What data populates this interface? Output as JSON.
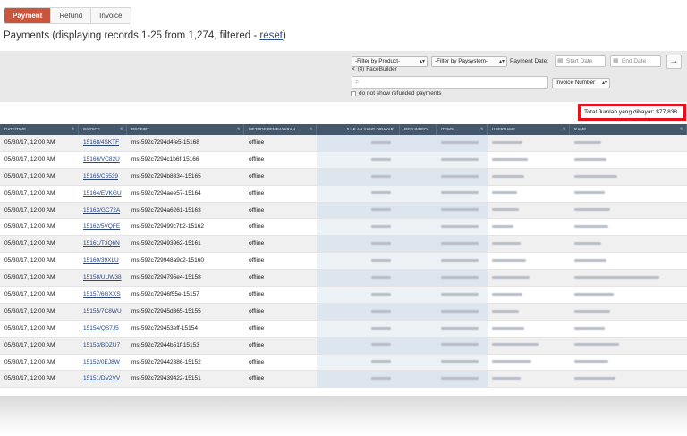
{
  "tabs": [
    {
      "label": "Payment",
      "active": true
    },
    {
      "label": "Refund",
      "active": false
    },
    {
      "label": "Invoice",
      "active": false
    }
  ],
  "title": {
    "prefix": "Payments (displaying records 1-25 from 1,274, filtered - ",
    "reset": "reset",
    "suffix": ")"
  },
  "filters": {
    "product": "-Filter by Product-",
    "paysystem": "-Filter by Paysystem-",
    "payment_date_label": "Payment Date:",
    "start_date_placeholder": "Start Date",
    "end_date_placeholder": "End Date",
    "chip_label": "(4) FaceBuilder",
    "search_placeholder": "",
    "search_field": "Invoice Number",
    "refund_checkbox_label": "do not show refunded payments"
  },
  "total_label": "Total Jumlah yang dibayar: $77,838",
  "columns": [
    "DATE/TIME",
    "INVOICE",
    "RECEIPT",
    "METODE PEMBAYARAN",
    "JUMLAH YANG DIBAYAR",
    "REFUNDED",
    "ITEMS",
    "USERNAME",
    "NAME"
  ],
  "rows": [
    {
      "date": "05/30/17, 12:00 AM",
      "invoice": "15168/4SKTF",
      "receipt": "ms-592c7294d4fe5-15168",
      "method": "offline"
    },
    {
      "date": "05/30/17, 12:00 AM",
      "invoice": "15166/VC82U",
      "receipt": "ms-592c7294c1b6f-15166",
      "method": "offline"
    },
    {
      "date": "05/30/17, 12:00 AM",
      "invoice": "15165/C5539",
      "receipt": "ms-592c7294b8334-15165",
      "method": "offline"
    },
    {
      "date": "05/30/17, 12:00 AM",
      "invoice": "15164/EVKGU",
      "receipt": "ms-592c7294aee57-15164",
      "method": "offline"
    },
    {
      "date": "05/30/17, 12:00 AM",
      "invoice": "15163/GC72A",
      "receipt": "ms-592c7294a6261-15163",
      "method": "offline"
    },
    {
      "date": "05/30/17, 12:00 AM",
      "invoice": "15162/5VQFE",
      "receipt": "ms-592c729499c7b2-15162",
      "method": "offline"
    },
    {
      "date": "05/30/17, 12:00 AM",
      "invoice": "15161/T3Q6N",
      "receipt": "ms-592c729493962-15161",
      "method": "offline"
    },
    {
      "date": "05/30/17, 12:00 AM",
      "invoice": "15160/39XLU",
      "receipt": "ms-592c729948a9c2-15160",
      "method": "offline"
    },
    {
      "date": "05/30/17, 12:00 AM",
      "invoice": "15158/UUW38",
      "receipt": "ms-592c7294795e4-15158",
      "method": "offline"
    },
    {
      "date": "05/30/17, 12:00 AM",
      "invoice": "15157/6GXXS",
      "receipt": "ms-592c72946f55e-15157",
      "method": "offline"
    },
    {
      "date": "05/30/17, 12:00 AM",
      "invoice": "15155/7C8WU",
      "receipt": "ms-592c72945d365-15155",
      "method": "offline"
    },
    {
      "date": "05/30/17, 12:00 AM",
      "invoice": "15154/QS7J5",
      "receipt": "ms-592c729453eff-15154",
      "method": "offline"
    },
    {
      "date": "05/30/17, 12:00 AM",
      "invoice": "15153/BDZU7",
      "receipt": "ms-592c72944b51f-15153",
      "method": "offline"
    },
    {
      "date": "05/30/17, 12:00 AM",
      "invoice": "15152/0EJ8W",
      "receipt": "ms-592c729442386-15152",
      "method": "offline"
    },
    {
      "date": "05/30/17, 12:00 AM",
      "invoice": "15151/DV2VV",
      "receipt": "ms-592c729439422-15151",
      "method": "offline"
    }
  ],
  "colors": {
    "accent_tab": "#c9553d",
    "header_bg": "#45576b",
    "total_border": "#e8101a",
    "link": "#29467f"
  },
  "icons": {
    "arrow": "arrow-right-icon",
    "calendar": "calendar-icon",
    "search": "search-icon",
    "remove": "close-icon",
    "sort": "sort-icon"
  }
}
